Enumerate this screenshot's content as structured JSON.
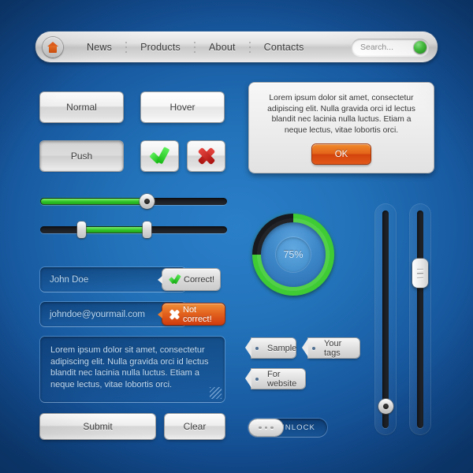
{
  "navbar": {
    "home_icon": "home-icon",
    "items": [
      {
        "label": "News"
      },
      {
        "label": "Products"
      },
      {
        "label": "About"
      },
      {
        "label": "Contacts"
      }
    ],
    "search": {
      "placeholder": "Search...",
      "value": "Search...",
      "indicator_color": "#47c441"
    }
  },
  "buttons": {
    "normal": "Normal",
    "hover": "Hover",
    "push": "Push",
    "check_icon": "check-icon",
    "cross_icon": "cross-icon",
    "submit": "Submit",
    "clear": "Clear"
  },
  "dialog": {
    "text": "Lorem ipsum dolor sit amet, consectetur adipiscing elit. Nulla gravida orci id lectus blandit nec lacinia nulla luctus. Etiam a neque lectus, vitae lobortis orci.",
    "ok_label": "OK",
    "ok_color": "#e4631a"
  },
  "sliders": {
    "single": {
      "value": 57,
      "fill_color": "#2fc125"
    },
    "range": {
      "start": 22,
      "end": 57,
      "fill_color": "#2fc125"
    },
    "vertical_round": {
      "value": 8
    },
    "vertical_rect": {
      "value": 72
    }
  },
  "form": {
    "name_value": "John Doe",
    "email_value": "johndoe@yourmail.com",
    "textarea_value": "Lorem ipsum dolor sit amet, consectetur adipiscing elit. Nulla gravida orci id lectus blandit nec lacinia nulla luctus. Etiam a neque lectus, vitae lobortis orci.",
    "badge_correct": "Correct!",
    "badge_wrong": "Not correct!"
  },
  "progress": {
    "label": "75%",
    "percent": 75,
    "arc_color": "#3ecb34",
    "track_color": "#17191c"
  },
  "tags": [
    {
      "label": "Sample"
    },
    {
      "label": "Your tags"
    },
    {
      "label": "For website"
    }
  ],
  "unlock": {
    "label": "UNLOCK",
    "grip_icon": "grip-dots-icon"
  }
}
